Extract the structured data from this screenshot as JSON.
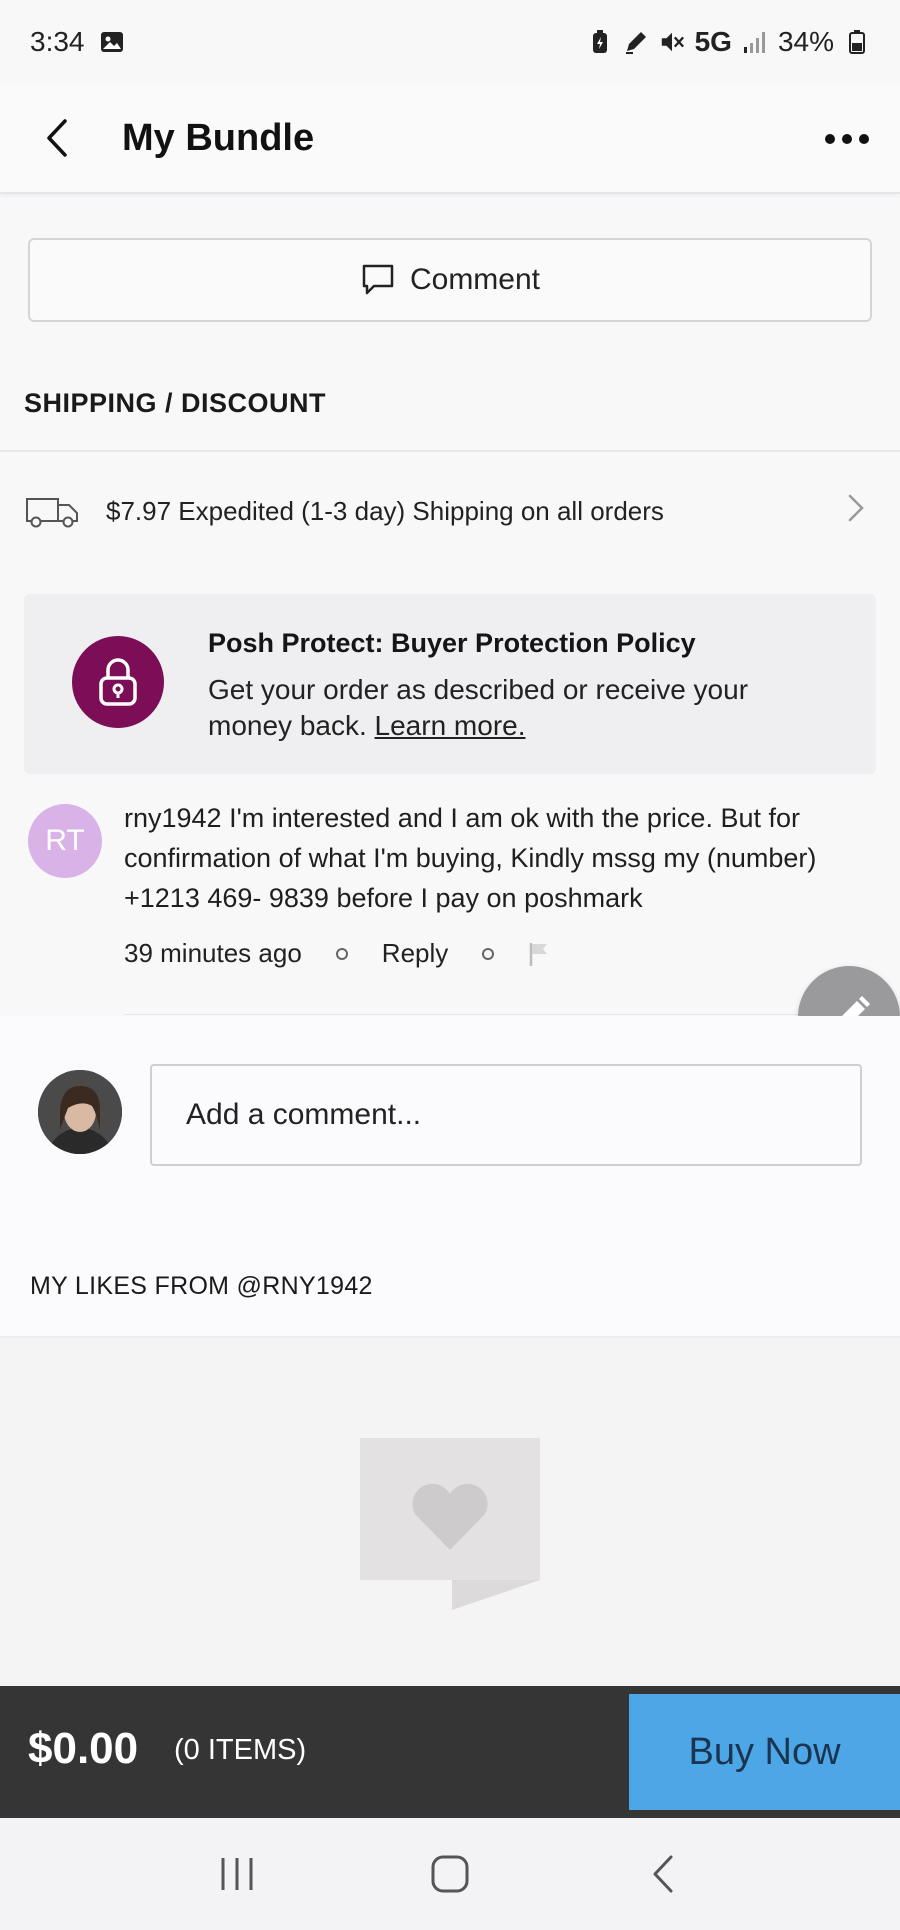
{
  "status_bar": {
    "time": "3:34",
    "network": "5G",
    "battery": "34%"
  },
  "header": {
    "title": "My Bundle"
  },
  "comment_button": {
    "label": "Comment"
  },
  "shipping": {
    "section_title": "SHIPPING / DISCOUNT",
    "text": "$7.97 Expedited (1-3 day) Shipping on all orders"
  },
  "protect": {
    "title": "Posh Protect: Buyer Protection Policy",
    "body": "Get your order as described or receive your money back.",
    "link": "Learn more.",
    "accent_color": "#7b0e56"
  },
  "comment": {
    "avatar_initials": "RT",
    "text": "rny1942 I'm interested and I am ok with the price. But for confirmation of what I'm buying, Kindly mssg my (number) +1213 469- 9839 before I pay on poshmark",
    "time": "39 minutes ago",
    "reply_label": "Reply"
  },
  "add_comment": {
    "placeholder": "Add a comment..."
  },
  "likes": {
    "title": "MY LIKES FROM @RNY1942"
  },
  "footer": {
    "total": "$0.00",
    "items": "(0 ITEMS)",
    "buy_label": "Buy Now",
    "buy_color": "#4da7e6"
  },
  "icons": {
    "back": "back-arrow-icon",
    "more": "more-dots-icon",
    "comment": "speech-bubble-icon",
    "truck": "truck-icon",
    "lock": "lock-icon",
    "flag": "flag-icon",
    "edit": "pencil-icon",
    "nav_recent": "recent-apps-icon",
    "nav_home": "home-icon",
    "nav_back": "nav-back-icon"
  }
}
